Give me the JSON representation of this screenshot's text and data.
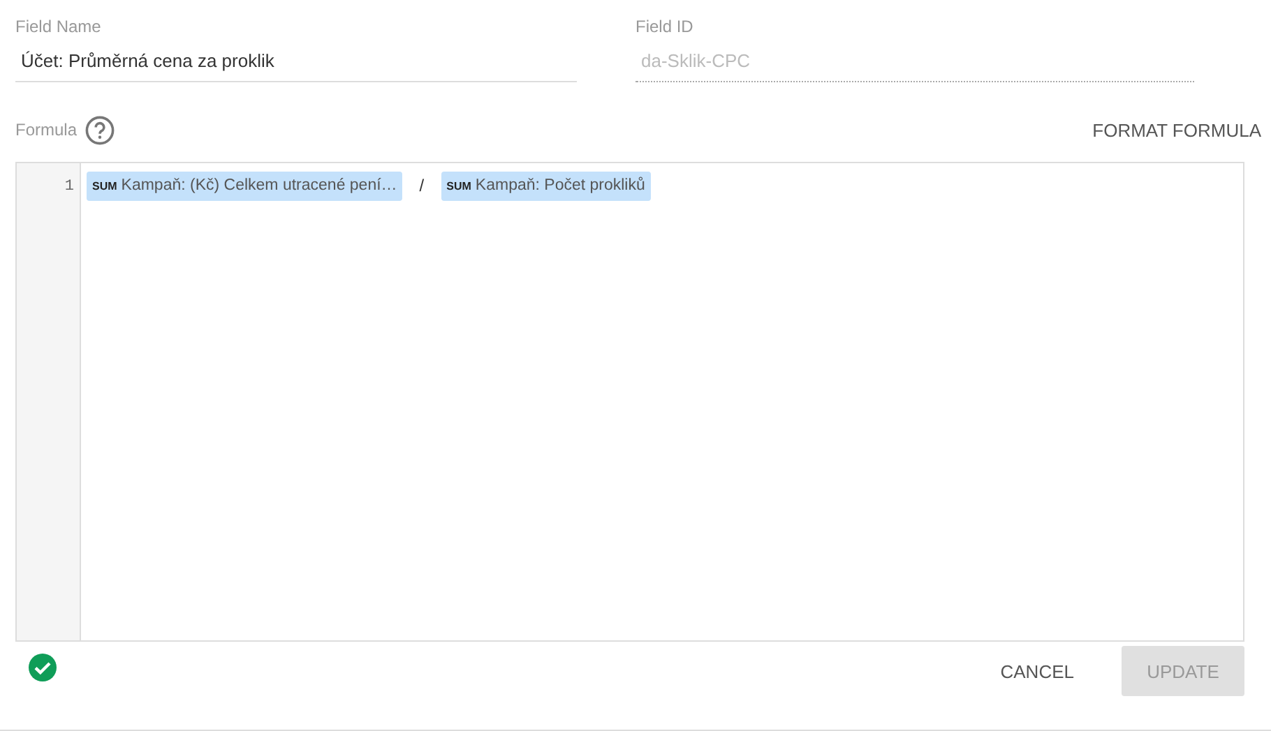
{
  "field_name": {
    "label": "Field Name",
    "value": "Účet: Průměrná cena za proklik",
    "disabled": false
  },
  "field_id": {
    "label": "Field ID",
    "value": "da-Sklik-CPC",
    "disabled": true
  },
  "formula": {
    "label": "Formula",
    "action": "FORMAT FORMULA",
    "valid": true,
    "lines": [
      {
        "number": "1",
        "tokens": [
          {
            "kind": "field",
            "aggregation": "SUM",
            "text": "Kampaň: (Kč) Celkem utracené pení…"
          },
          {
            "kind": "operator",
            "text": "/"
          },
          {
            "kind": "field",
            "aggregation": "SUM",
            "text": "Kampaň: Počet prokliků"
          }
        ]
      }
    ]
  },
  "buttons": [
    {
      "label": "CANCEL",
      "disabled": false
    },
    {
      "label": "UPDATE",
      "disabled": true
    }
  ]
}
